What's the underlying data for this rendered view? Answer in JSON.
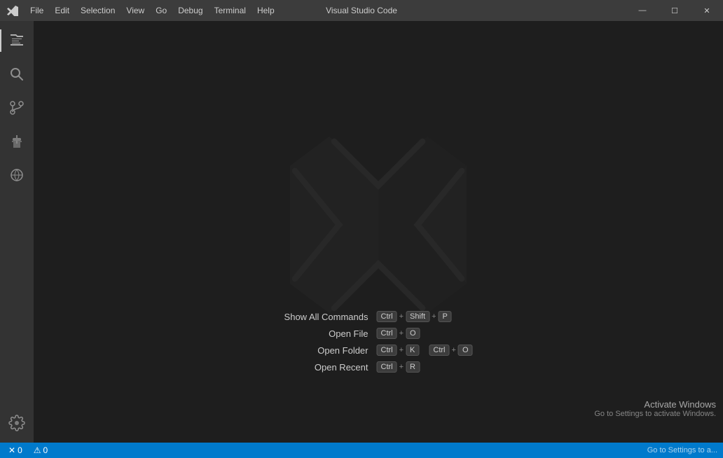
{
  "titlebar": {
    "menu_items": [
      "File",
      "Edit",
      "Selection",
      "View",
      "Go",
      "Debug",
      "Terminal",
      "Help"
    ],
    "title": "Visual Studio Code",
    "minimize_label": "—",
    "maximize_label": "☐",
    "close_label": "✕"
  },
  "activity_bar": {
    "icons": [
      {
        "name": "explorer-icon",
        "label": "Explorer",
        "active": true
      },
      {
        "name": "search-icon",
        "label": "Search",
        "active": false
      },
      {
        "name": "source-control-icon",
        "label": "Source Control",
        "active": false
      },
      {
        "name": "extensions-icon",
        "label": "Extensions",
        "active": false
      },
      {
        "name": "remote-explorer-icon",
        "label": "Remote Explorer",
        "active": false
      }
    ],
    "bottom_icons": [
      {
        "name": "settings-icon",
        "label": "Settings",
        "active": false
      }
    ]
  },
  "welcome": {
    "commands": [
      {
        "label": "Show All Commands",
        "keys": [
          {
            "segments": [
              "Ctrl",
              "+",
              "Shift",
              "+",
              "P"
            ]
          }
        ]
      },
      {
        "label": "Open File",
        "keys": [
          {
            "segments": [
              "Ctrl",
              "+",
              "O"
            ]
          }
        ]
      },
      {
        "label": "Open Folder",
        "keys": [
          {
            "segments": [
              "Ctrl",
              "+",
              "K"
            ]
          },
          {
            "segments": [
              "Ctrl",
              "+",
              "O"
            ]
          }
        ]
      },
      {
        "label": "Open Recent",
        "keys": [
          {
            "segments": [
              "Ctrl",
              "+",
              "R"
            ]
          }
        ]
      }
    ]
  },
  "statusbar": {
    "left": [
      {
        "icon": "error-icon",
        "count": "0"
      },
      {
        "icon": "warning-icon",
        "count": "0"
      }
    ],
    "right_text": "Go to Settings to a..."
  },
  "activate_windows": {
    "line1": "Activate Windows",
    "line2": "Go to Settings to activate Windows."
  }
}
